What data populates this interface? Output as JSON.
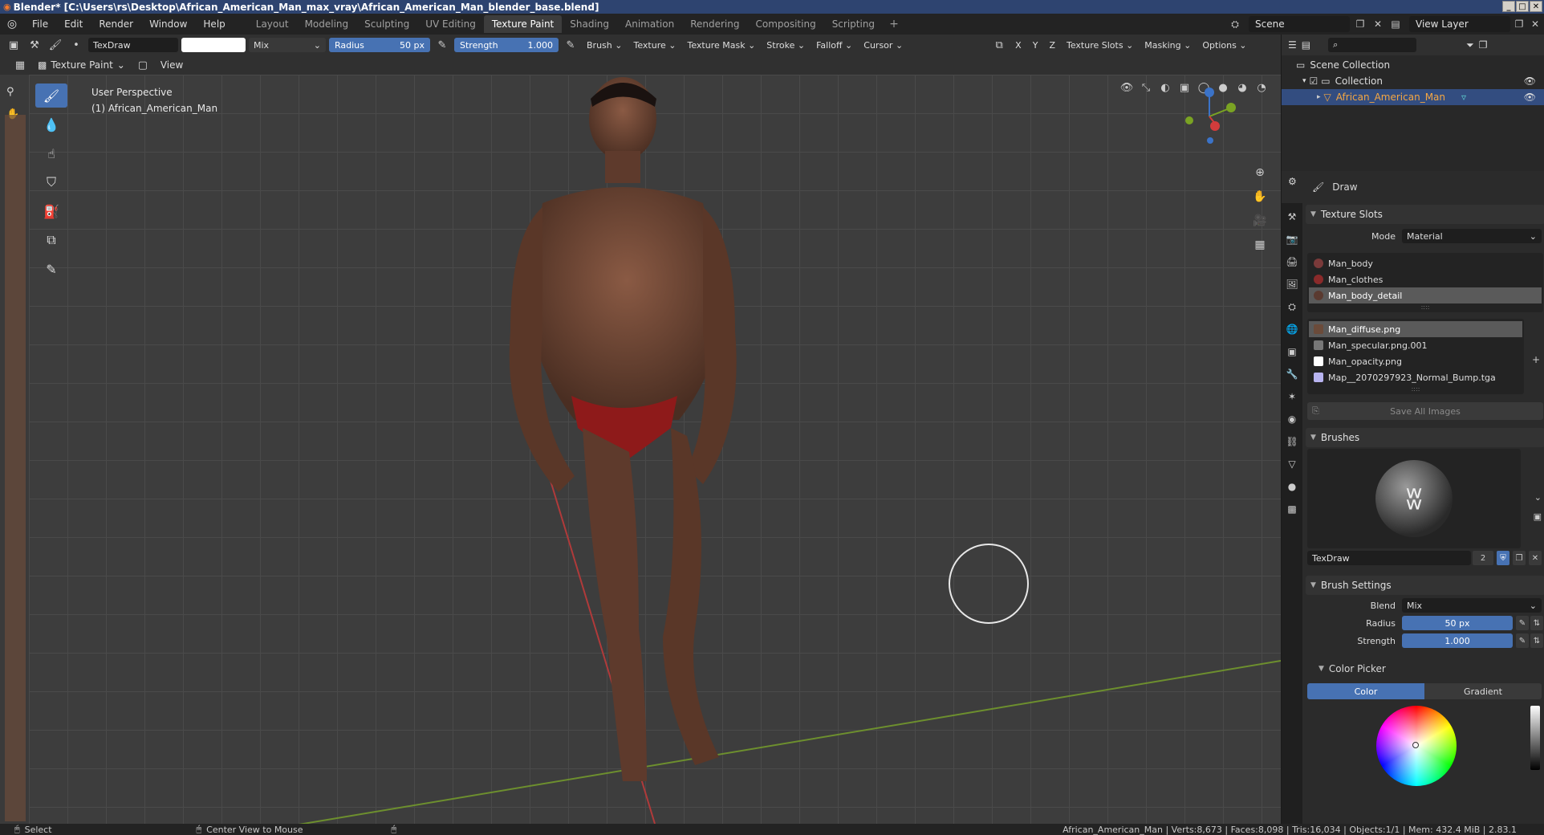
{
  "window": {
    "title": "Blender* [C:\\Users\\rs\\Desktop\\African_American_Man_max_vray\\African_American_Man_blender_base.blend]"
  },
  "menus": [
    "File",
    "Edit",
    "Render",
    "Window",
    "Help"
  ],
  "workspaces": [
    "Layout",
    "Modeling",
    "Sculpting",
    "UV Editing",
    "Texture Paint",
    "Shading",
    "Animation",
    "Rendering",
    "Compositing",
    "Scripting"
  ],
  "active_workspace": "Texture Paint",
  "scene": "Scene",
  "view_layer": "View Layer",
  "tool": {
    "brush_name": "TexDraw",
    "blend": "Mix",
    "radius_label": "Radius",
    "radius_value": "50 px",
    "strength_label": "Strength",
    "strength_value": "1.000",
    "color": "#ffffff",
    "menus": [
      "Brush",
      "Texture",
      "Texture Mask",
      "Stroke",
      "Falloff",
      "Cursor"
    ],
    "axis": [
      "X",
      "Y",
      "Z"
    ],
    "right_menus": [
      "Texture Slots",
      "Masking",
      "Options"
    ]
  },
  "mode": {
    "label": "Texture Paint",
    "view": "View"
  },
  "viewport": {
    "line1": "User Perspective",
    "line2": "(1) African_American_Man"
  },
  "outliner": {
    "root": "Scene Collection",
    "collection": "Collection",
    "object": "African_American_Man"
  },
  "properties": {
    "active_tool": "Draw",
    "texture_slots_title": "Texture Slots",
    "mode_label": "Mode",
    "mode_value": "Material",
    "materials": [
      {
        "name": "Man_body",
        "color": "#7a3a3a"
      },
      {
        "name": "Man_clothes",
        "color": "#8a2a2a"
      },
      {
        "name": "Man_body_detail",
        "color": "#5a3a30"
      }
    ],
    "images": [
      {
        "name": "Man_diffuse.png",
        "color": "#6b4b3a"
      },
      {
        "name": "Man_specular.png.001",
        "color": "#777777"
      },
      {
        "name": "Man_opacity.png",
        "color": "#ffffff"
      },
      {
        "name": "Map__2070297923_Normal_Bump.tga",
        "color": "#b8b4f0"
      }
    ],
    "save_all": "Save All Images",
    "brushes_title": "Brushes",
    "brush_name": "TexDraw",
    "brush_users": "2",
    "brush_settings_title": "Brush Settings",
    "blend_label": "Blend",
    "blend_value": "Mix",
    "radius_label": "Radius",
    "radius_value": "50 px",
    "strength_label": "Strength",
    "strength_value": "1.000",
    "color_picker_title": "Color Picker",
    "color_tab": "Color",
    "gradient_tab": "Gradient"
  },
  "status": {
    "select": "Select",
    "center_view": "Center View to Mouse",
    "stats": "African_American_Man | Verts:8,673 | Faces:8,098 | Tris:16,034 | Objects:1/1 | Mem: 432.4 MiB | 2.83.1"
  }
}
